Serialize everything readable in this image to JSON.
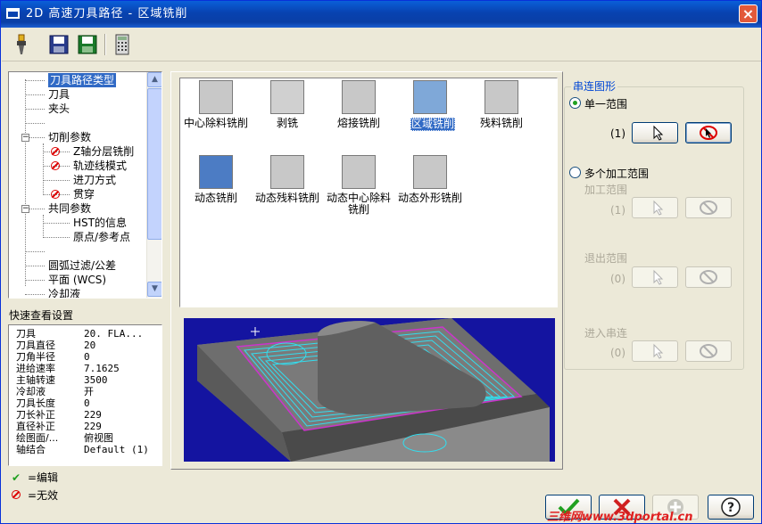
{
  "window": {
    "title": "2D 高速刀具路径 - 区域铣削",
    "close_label": "×"
  },
  "toolbar": {
    "buttons": [
      {
        "name": "tool-icon"
      },
      {
        "name": "save-icon"
      },
      {
        "name": "save-as-icon"
      },
      {
        "name": "calculator-icon"
      }
    ]
  },
  "tree": {
    "items": [
      {
        "label": "刀具路径类型",
        "selected": true
      },
      {
        "label": "刀具"
      },
      {
        "label": "夹头"
      },
      {
        "label": ""
      },
      {
        "label": "切削参数"
      },
      {
        "label": "Z轴分层铣削"
      },
      {
        "label": "轨迹线模式"
      },
      {
        "label": "进刀方式"
      },
      {
        "label": "贯穿"
      },
      {
        "label": "共同参数"
      },
      {
        "label": "HST的信息"
      },
      {
        "label": "原点/参考点"
      },
      {
        "label": ""
      },
      {
        "label": "圆弧过滤/公差"
      },
      {
        "label": "平面 (WCS)"
      },
      {
        "label": "冷却液"
      }
    ],
    "expander_minus": "−",
    "scroll_up": "▲",
    "scroll_down": "▼"
  },
  "quick_settings": {
    "title": "快速查看设置",
    "rows": [
      {
        "key": "刀具",
        "value": "20. FLA..."
      },
      {
        "key": "刀具直径",
        "value": "20"
      },
      {
        "key": "刀角半径",
        "value": "0"
      },
      {
        "key": "进给速率",
        "value": "7.1625"
      },
      {
        "key": "主轴转速",
        "value": "3500"
      },
      {
        "key": "冷却液",
        "value": "开"
      },
      {
        "key": "刀具长度",
        "value": "0"
      },
      {
        "key": "刀长补正",
        "value": "229"
      },
      {
        "key": "直径补正",
        "value": "229"
      },
      {
        "key": "绘图面/...",
        "value": "俯视图"
      },
      {
        "key": "轴结合",
        "value": "Default (1)"
      }
    ]
  },
  "legend": {
    "edit_mark": "✔",
    "edit_label": "=编辑",
    "invalid_label": "=无效"
  },
  "toolpath_types": [
    {
      "label": "中心除料铣削"
    },
    {
      "label": "剥铣"
    },
    {
      "label": "熔接铣削"
    },
    {
      "label": "区域铣削",
      "selected": true
    },
    {
      "label": "残料铣削"
    },
    {
      "label": "动态铣削"
    },
    {
      "label": "动态残料铣削"
    },
    {
      "label": "动态中心除料铣削"
    },
    {
      "label": "动态外形铣削"
    }
  ],
  "chain": {
    "group_label": "串连图形",
    "single_range": {
      "label": "单一范围",
      "count": "(1)",
      "checked": true
    },
    "multi_range": {
      "label": "多个加工范围",
      "checked": false
    },
    "machining_range": {
      "label": "加工范围",
      "count": "(1)"
    },
    "exit_range": {
      "label": "退出范围",
      "count": "(0)"
    },
    "entry_chain": {
      "label": "进入串连",
      "count": "(0)"
    }
  },
  "bottom_buttons": [
    {
      "name": "ok-button",
      "icon": "check-icon",
      "enabled": true
    },
    {
      "name": "cancel-button",
      "icon": "cross-icon",
      "enabled": true
    },
    {
      "name": "add-button",
      "icon": "plus-icon",
      "enabled": false
    },
    {
      "name": "help-button",
      "icon": "question-icon",
      "enabled": true,
      "glyph": "?"
    }
  ],
  "watermark": "三维网www.3dportal.cn"
}
